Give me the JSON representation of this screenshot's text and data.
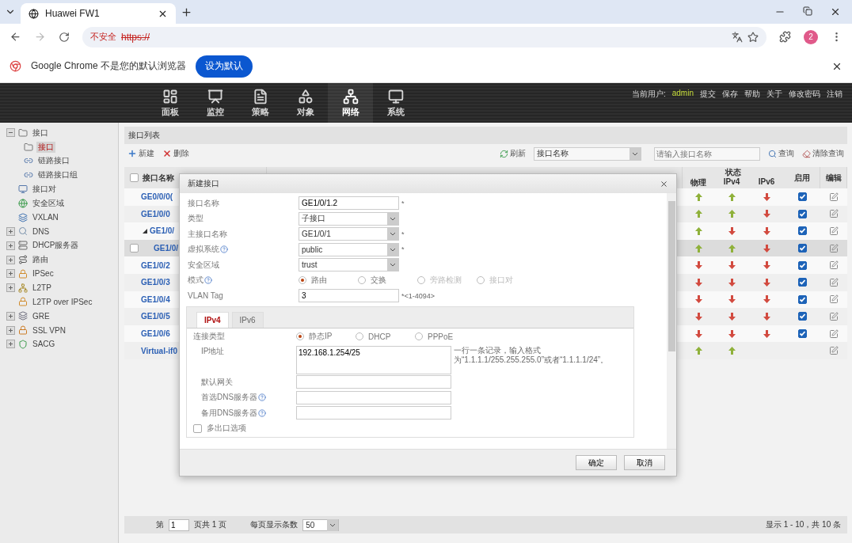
{
  "browser": {
    "tab_title": "Huawei FW1",
    "security_label": "不安全",
    "url": "https://",
    "profile_badge": "2"
  },
  "infobar": {
    "message": "Google Chrome 不是您的默认浏览器",
    "button": "设为默认"
  },
  "nav": [
    {
      "label": "面板",
      "selected": false
    },
    {
      "label": "监控",
      "selected": false
    },
    {
      "label": "策略",
      "selected": false
    },
    {
      "label": "对象",
      "selected": false
    },
    {
      "label": "网络",
      "selected": true
    },
    {
      "label": "系统",
      "selected": false
    }
  ],
  "user_bar": {
    "user_label": "当前用户:",
    "user": "admin",
    "links": [
      "提交",
      "保存",
      "帮助",
      "关于",
      "修改密码",
      "注销"
    ]
  },
  "sidebar": {
    "items": [
      {
        "label": "接口",
        "expanded": true,
        "selected": false,
        "children": [
          {
            "label": "接口",
            "selected": true
          },
          {
            "label": "链路接口",
            "selected": false
          },
          {
            "label": "链路接口组",
            "selected": false
          }
        ]
      },
      {
        "label": "接口对",
        "selected": false
      },
      {
        "label": "安全区域",
        "selected": false
      },
      {
        "label": "VXLAN",
        "selected": false
      },
      {
        "label": "DNS",
        "expanded": false,
        "selected": false
      },
      {
        "label": "DHCP服务器",
        "expanded": false,
        "selected": false
      },
      {
        "label": "路由",
        "expanded": false,
        "selected": false
      },
      {
        "label": "IPSec",
        "expanded": false,
        "selected": false
      },
      {
        "label": "L2TP",
        "expanded": false,
        "selected": false
      },
      {
        "label": "L2TP over IPSec",
        "selected": false
      },
      {
        "label": "GRE",
        "expanded": false,
        "selected": false
      },
      {
        "label": "SSL VPN",
        "expanded": false,
        "selected": false
      },
      {
        "label": "SACG",
        "expanded": false,
        "selected": false
      }
    ]
  },
  "panel": {
    "title": "接口列表",
    "toolbar": [
      "新建",
      "删除"
    ],
    "filter": {
      "refresh": "刷新",
      "field": "接口名称",
      "placeholder": "请输入接口名称",
      "search": "查询",
      "clear": "清除查询"
    },
    "table": {
      "select_all_checked": false,
      "columns": {
        "name": "接口名称",
        "status": "状态",
        "physical": "物理",
        "ipv4": "IPv4",
        "ipv6": "IPv6",
        "enabled": "启用",
        "edit": "编辑"
      },
      "rows": [
        {
          "name": "GE0/0/0(",
          "physical_up": true,
          "ipv4_up": true,
          "ipv6_up": false,
          "enabled": true,
          "selected": false
        },
        {
          "name": "GE1/0/0",
          "physical_up": true,
          "ipv4_up": true,
          "ipv6_up": false,
          "enabled": true,
          "selected": false
        },
        {
          "name": "GE1/0/",
          "expanded": true,
          "physical_up": true,
          "ipv4_up": false,
          "ipv6_up": false,
          "enabled": true,
          "selected": false,
          "children": [
            {
              "name": "GE1/0/",
              "physical_up": true,
              "ipv4_up": true,
              "ipv6_up": false,
              "enabled": true,
              "selected": true
            }
          ]
        },
        {
          "name": "GE1/0/2",
          "physical_up": false,
          "ipv4_up": false,
          "ipv6_up": false,
          "enabled": true,
          "selected": false
        },
        {
          "name": "GE1/0/3",
          "physical_up": false,
          "ipv4_up": false,
          "ipv6_up": false,
          "enabled": true,
          "selected": false
        },
        {
          "name": "GE1/0/4",
          "physical_up": false,
          "ipv4_up": false,
          "ipv6_up": false,
          "enabled": true,
          "selected": false
        },
        {
          "name": "GE1/0/5",
          "physical_up": false,
          "ipv4_up": false,
          "ipv6_up": false,
          "enabled": true,
          "selected": false
        },
        {
          "name": "GE1/0/6",
          "physical_up": false,
          "ipv4_up": false,
          "ipv6_up": false,
          "enabled": true,
          "selected": false
        },
        {
          "name": "Virtual-if0",
          "physical_up": true,
          "ipv4_up": true,
          "selected": false
        }
      ]
    },
    "pager": {
      "page_label": "第",
      "page": "1",
      "page_total": "页共 1 页",
      "per_page_label": "每页显示条数",
      "per_page": "50",
      "summary": "显示 1 - 10，共 10 条"
    }
  },
  "dialog": {
    "title": "新建接口",
    "fields": [
      {
        "kind": "text",
        "label": "接口名称",
        "value": "GE1/0/1.2",
        "note": "*"
      },
      {
        "kind": "select",
        "label": "类型",
        "value": "子接口"
      },
      {
        "kind": "select",
        "label": "主接口名称",
        "value": "GE1/0/1",
        "note": "*"
      },
      {
        "kind": "select",
        "label": "虚拟系统",
        "help": true,
        "value": "public",
        "note": "*"
      },
      {
        "kind": "select",
        "label": "安全区域",
        "value": "trust"
      },
      {
        "kind": "radio",
        "label": "模式",
        "help": true,
        "options": [
          {
            "label": "路由",
            "selected": true,
            "disabled": false
          },
          {
            "label": "交换",
            "selected": false,
            "disabled": false
          },
          {
            "label": "旁路检测",
            "selected": false,
            "disabled": true
          },
          {
            "label": "接口对",
            "selected": false,
            "disabled": true
          }
        ]
      },
      {
        "kind": "text",
        "label": "VLAN Tag",
        "value": "3",
        "note": "*<1-4094>"
      }
    ],
    "tabs": [
      {
        "label": "IPv4",
        "selected": true
      },
      {
        "label": "IPv6",
        "selected": false
      }
    ],
    "ipv4_fields": [
      {
        "kind": "radio",
        "label": "连接类型",
        "options": [
          {
            "label": "静态IP",
            "selected": true,
            "disabled": false
          },
          {
            "label": "DHCP",
            "selected": false,
            "disabled": false
          },
          {
            "label": "PPPoE",
            "selected": false,
            "disabled": false
          }
        ]
      },
      {
        "kind": "textarea",
        "label": "IP地址",
        "value": "192.168.1.254/25",
        "note": "一行一条记录，输入格式为“1.1.1.1/255.255.255.0”或者“1.1.1.1/24”。"
      },
      {
        "kind": "text",
        "label": "默认网关"
      },
      {
        "kind": "text",
        "label": "首选DNS服务器",
        "help": true
      },
      {
        "kind": "text",
        "label": "备用DNS服务器",
        "help": true
      },
      {
        "kind": "checkbox",
        "label": "多出口选项",
        "checked": false
      }
    ],
    "buttons": [
      "确定",
      "取消"
    ]
  }
}
